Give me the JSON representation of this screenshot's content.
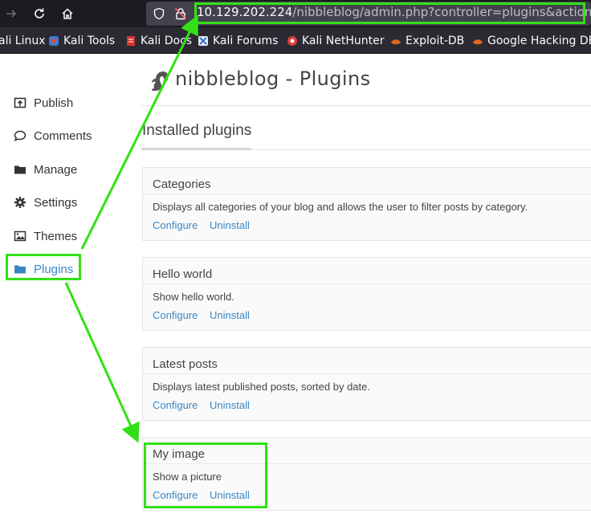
{
  "browser": {
    "url_host": "10.129.202.224",
    "url_path": "/nibbleblog/admin.php?controller=plugins&action=list",
    "bookmarks": [
      {
        "label": "ali Linux",
        "icon": "kali-icon"
      },
      {
        "label": "Kali Tools",
        "icon": "kali-tools-icon"
      },
      {
        "label": "Kali Docs",
        "icon": "kali-docs-icon"
      },
      {
        "label": "Kali Forums",
        "icon": "kali-forums-icon"
      },
      {
        "label": "Kali NetHunter",
        "icon": "nethunter-icon"
      },
      {
        "label": "Exploit-DB",
        "icon": "exploit-db-icon"
      },
      {
        "label": "Google Hacking DB",
        "icon": "ghdb-icon"
      }
    ]
  },
  "sidebar": {
    "items": [
      {
        "label": "Publish",
        "icon": "publish-icon"
      },
      {
        "label": "Comments",
        "icon": "comment-icon"
      },
      {
        "label": "Manage",
        "icon": "folder-icon"
      },
      {
        "label": "Settings",
        "icon": "gear-icon"
      },
      {
        "label": "Themes",
        "icon": "image-icon"
      },
      {
        "label": "Plugins",
        "icon": "folder-icon",
        "active": true
      }
    ]
  },
  "header": {
    "title": "nibbleblog - Plugins"
  },
  "main": {
    "section_title": "Installed plugins",
    "plugins": [
      {
        "name": "Categories",
        "description": "Displays all categories of your blog and allows the user to filter posts by category.",
        "configure": "Configure",
        "uninstall": "Uninstall"
      },
      {
        "name": "Hello world",
        "description": "Show hello world.",
        "configure": "Configure",
        "uninstall": "Uninstall"
      },
      {
        "name": "Latest posts",
        "description": "Displays latest published posts, sorted by date.",
        "configure": "Configure",
        "uninstall": "Uninstall"
      },
      {
        "name": "My image",
        "description": "Show a picture",
        "configure": "Configure",
        "uninstall": "Uninstall"
      }
    ]
  },
  "colors": {
    "accent_link": "#3a87c4",
    "annotation_green": "#33e016",
    "chrome_dark": "#1c1b22"
  }
}
